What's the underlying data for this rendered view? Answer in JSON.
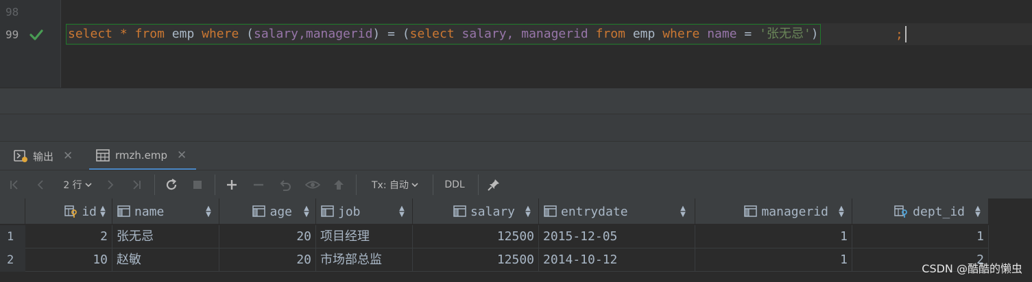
{
  "editor": {
    "lines": [
      {
        "number": "98"
      },
      {
        "number": "99"
      }
    ],
    "code": {
      "t1": "select",
      "t2": "*",
      "t3": "from",
      "t4": "emp",
      "t5": "where",
      "t6": "(",
      "t7": "salary",
      "t8": ",",
      "t9": "managerid",
      "t10": ")",
      "t11": "=",
      "t12": "(",
      "t13": "select",
      "t14": "salary",
      "t15": ",",
      "t16": "managerid",
      "t17": "from",
      "t18": "emp",
      "t19": "where",
      "t20": "name",
      "t21": "=",
      "t22": "'张无忌'",
      "t23": ")",
      "t24": ";"
    },
    "colors": {
      "keyword": "#cc7832",
      "column": "#9876aa",
      "string": "#6a8759",
      "check": "#499c54"
    }
  },
  "tabs": [
    {
      "label": "输出",
      "icon": "console-output-icon"
    },
    {
      "label": "rmzh.emp",
      "icon": "table-icon"
    }
  ],
  "toolbar": {
    "rows_label": "2 行",
    "tx_label": "Tx: 自动",
    "ddl_label": "DDL"
  },
  "grid": {
    "columns": [
      {
        "name": "id",
        "icon": "primary-key-column-icon"
      },
      {
        "name": "name",
        "icon": "column-icon"
      },
      {
        "name": "age",
        "icon": "column-icon"
      },
      {
        "name": "job",
        "icon": "column-icon"
      },
      {
        "name": "salary",
        "icon": "column-icon"
      },
      {
        "name": "entrydate",
        "icon": "column-icon"
      },
      {
        "name": "managerid",
        "icon": "column-icon"
      },
      {
        "name": "dept_id",
        "icon": "foreign-key-column-icon"
      }
    ],
    "rows": [
      {
        "num": "1",
        "id": "2",
        "name": "张无忌",
        "age": "20",
        "job": "项目经理",
        "salary": "12500",
        "entrydate": "2015-12-05",
        "managerid": "1",
        "dept_id": "1"
      },
      {
        "num": "2",
        "id": "10",
        "name": "赵敏",
        "age": "20",
        "job": "市场部总监",
        "salary": "12500",
        "entrydate": "2014-10-12",
        "managerid": "1",
        "dept_id": "2"
      }
    ]
  },
  "watermark": "CSDN @酷酷的懒虫"
}
